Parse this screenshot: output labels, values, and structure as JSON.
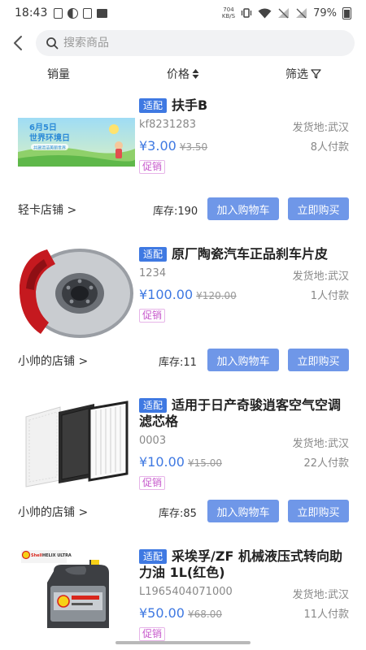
{
  "status_bar": {
    "time": "18:43",
    "net_speed_top": "704",
    "net_speed_bottom": "KB/S",
    "battery": "79%"
  },
  "search": {
    "placeholder": "搜索商品"
  },
  "sort": {
    "sales": "销量",
    "price": "价格",
    "filter": "筛选"
  },
  "products": [
    {
      "tag": "适配",
      "title": "扶手B",
      "code": "kf8231283",
      "origin": "发货地:武汉",
      "price": "¥3.00",
      "old_price": "¥3.50",
      "buyers": "8人付款",
      "promo": "促销",
      "shop": "轻卡店铺 >",
      "stock": "库存:190",
      "cart_label": "加入购物车",
      "buy_label": "立即购买",
      "thumb_banner_line1": "6月5日",
      "thumb_banner_line2": "世界环境日",
      "thumb_banner_line3": "共建清洁美丽世界"
    },
    {
      "tag": "适配",
      "title": "原厂陶瓷汽车正品刹车片皮",
      "code": "1234",
      "origin": "发货地:武汉",
      "price": "¥100.00",
      "old_price": "¥120.00",
      "buyers": "1人付款",
      "promo": "促销",
      "shop": "小帅的店铺 >",
      "stock": "库存:11",
      "cart_label": "加入购物车",
      "buy_label": "立即购买"
    },
    {
      "tag": "适配",
      "title": "适用于日产奇骏逍客空气空调滤芯格",
      "code": "0003",
      "origin": "发货地:武汉",
      "price": "¥10.00",
      "old_price": "¥15.00",
      "buyers": "22人付款",
      "promo": "促销",
      "shop": "小帅的店铺 >",
      "stock": "库存:85",
      "cart_label": "加入购物车",
      "buy_label": "立即购买"
    },
    {
      "tag": "适配",
      "title": "采埃孚/ZF 机械液压式转向助力油 1L(红色)",
      "code": "L1965404071000",
      "origin": "发货地:武汉",
      "price": "¥50.00",
      "old_price": "¥68.00",
      "buyers": "11人付款",
      "promo": "促销",
      "thumb_brand": "Shell",
      "thumb_product": "HELIX ULTRA"
    }
  ],
  "colors": {
    "accent": "#3f79e2",
    "button": "#6f97e8",
    "promo": "#c657cb"
  }
}
